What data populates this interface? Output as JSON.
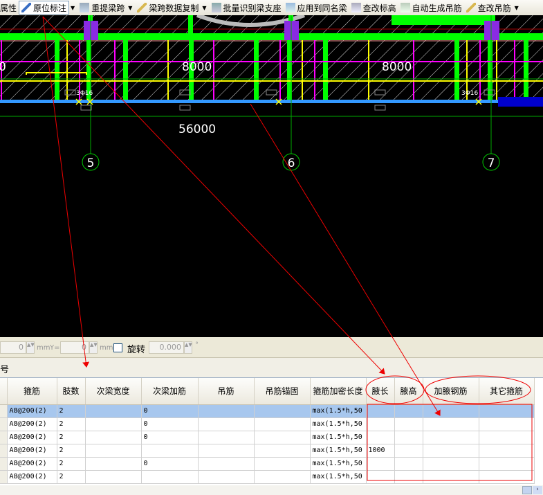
{
  "toolbar": {
    "items": [
      {
        "label": "属性",
        "icon": "properties-icon"
      },
      {
        "label": "原位标注",
        "icon": "in-place-annotation-icon",
        "active": true,
        "dropdown": true
      },
      {
        "label": "重提梁跨",
        "icon": "re-extract-span-icon",
        "dropdown": true
      },
      {
        "label": "梁跨数据复制",
        "icon": "copy-span-data-icon",
        "dropdown": true
      },
      {
        "label": "批量识别梁支座",
        "icon": "batch-identify-support-icon"
      },
      {
        "label": "应用到同名梁",
        "icon": "apply-same-name-icon"
      },
      {
        "label": "查改标高",
        "icon": "edit-elevation-icon"
      },
      {
        "label": "自动生成吊筋",
        "icon": "auto-hanger-icon"
      },
      {
        "label": "查改吊筋",
        "icon": "edit-hanger-icon",
        "dropdown": true
      }
    ]
  },
  "cad": {
    "dimensions": [
      "0",
      "8000",
      "8000",
      "56000"
    ],
    "axes": [
      "5",
      "6",
      "7"
    ],
    "rebar_labels": [
      "3Φ16",
      "3Φ16"
    ],
    "colors": {
      "background": "#000000",
      "column": "#00ff00",
      "stirrup": "#ffff00",
      "beam_rebar": "#ff00ff",
      "support": "#8a2be2",
      "axis": "#00a000",
      "annotation": "#ff0000",
      "beam_edge": "#3399ff"
    }
  },
  "coordbar": {
    "x_value": "0",
    "y_label": "Y=",
    "y_value": "0",
    "unit": "mm",
    "rotate_label": "旋转",
    "rotate_checked": false,
    "angle_value": "0.000",
    "degree": "°"
  },
  "label_bar": {
    "text": "号"
  },
  "table": {
    "columns": [
      "箍筋",
      "肢数",
      "次梁宽度",
      "次梁加筋",
      "吊筋",
      "吊筋锚固",
      "箍筋加密长度",
      "腋长",
      "腋高",
      "加腋钢筋",
      "其它箍筋"
    ],
    "rows": [
      [
        "A8@200(2)",
        "2",
        "",
        "0",
        "",
        "",
        "max(1.5*h,50",
        "",
        "",
        "",
        ""
      ],
      [
        "A8@200(2)",
        "2",
        "",
        "0",
        "",
        "",
        "max(1.5*h,50",
        "",
        "",
        "",
        ""
      ],
      [
        "A8@200(2)",
        "2",
        "",
        "0",
        "",
        "",
        "max(1.5*h,50",
        "",
        "",
        "",
        ""
      ],
      [
        "A8@200(2)",
        "2",
        "",
        "",
        "",
        "",
        "max(1.5*h,50",
        "1000",
        "",
        "",
        ""
      ],
      [
        "A8@200(2)",
        "2",
        "",
        "0",
        "",
        "",
        "max(1.5*h,50",
        "",
        "",
        "",
        ""
      ],
      [
        "A8@200(2)",
        "2",
        "",
        "",
        "",
        "",
        "max(1.5*h,50",
        "",
        "",
        "",
        ""
      ]
    ],
    "selected_row": 0
  }
}
